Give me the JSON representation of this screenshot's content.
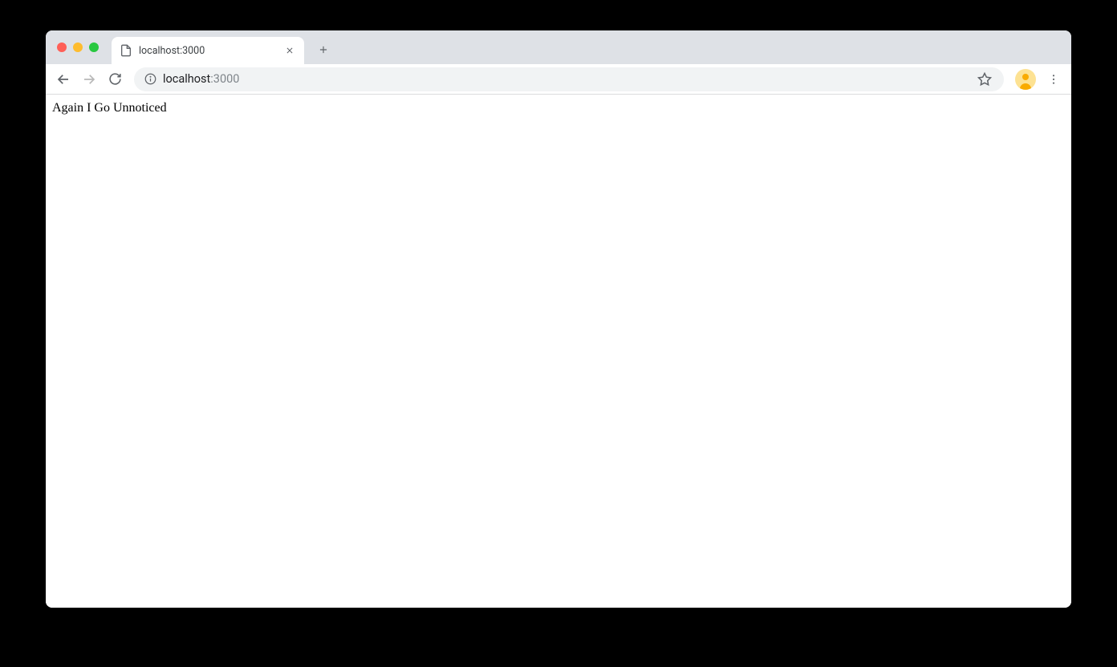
{
  "tab": {
    "title": "localhost:3000"
  },
  "address": {
    "host": "localhost",
    "port": ":3000"
  },
  "page": {
    "body_text": "Again I Go Unnoticed"
  }
}
